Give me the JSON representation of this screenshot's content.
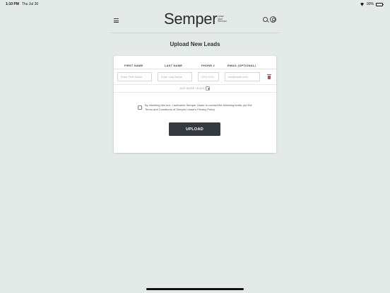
{
  "status_bar": {
    "time": "1:10 PM",
    "date": "Thu Jul 30",
    "battery": "90%",
    "battery_level": 0.9
  },
  "header": {
    "logo_text": "Semper",
    "logo_tagline": "Lease\nStart\nRenewal",
    "menu_icon": "hamburger-menu-icon",
    "search_icon": "search-icon",
    "account_icon": "account-circle-icon"
  },
  "page": {
    "title": "Upload New Leads"
  },
  "form": {
    "columns": [
      "FIRST NAME",
      "LAST NAME",
      "PHONE #",
      "EMAIL (OPTIONAL)"
    ],
    "row": {
      "first_name_placeholder": "Enter First Name",
      "last_name_placeholder": "Enter Last Name",
      "phone_placeholder": "XXX-XXX-",
      "email_placeholder": "me@email.com"
    },
    "add_more_label": "ADD MORE LEADS",
    "consent_text": "By checking this box, I authorize Semper Lease to contact the following leads, per the Terms and Conditions of Semper Lease's Privacy Policy.",
    "upload_label": "UPLOAD"
  },
  "colors": {
    "background": "#e4eae8",
    "button": "#343a40",
    "trash": "#c0504d"
  }
}
